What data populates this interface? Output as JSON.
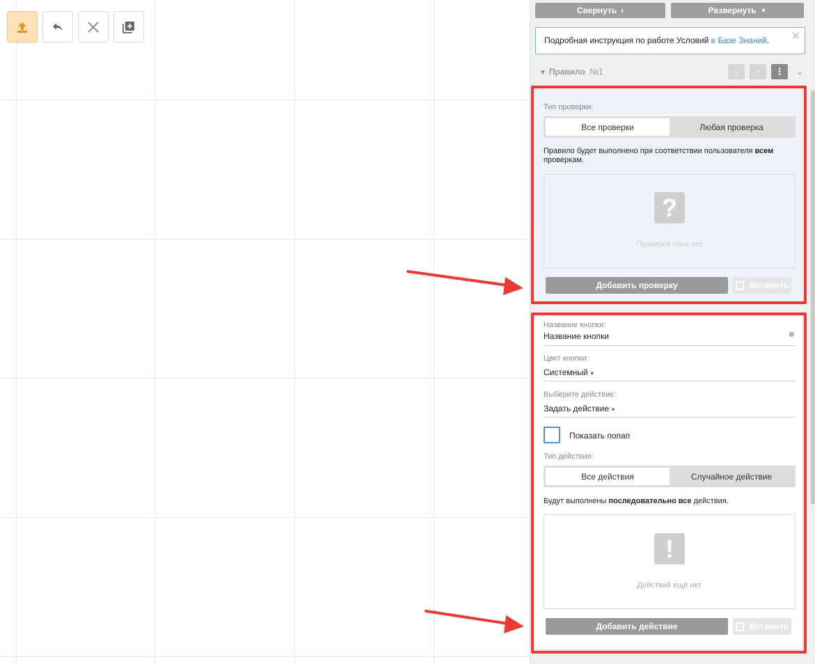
{
  "toolbar": {
    "buttons": [
      {
        "name": "upload-icon",
        "active": true
      },
      {
        "name": "undo-icon",
        "active": false
      },
      {
        "name": "close-icon",
        "active": false
      },
      {
        "name": "add-copy-icon",
        "active": false
      }
    ]
  },
  "panel": {
    "collapse_label": "Свернуть",
    "expand_label": "Развернуть",
    "info_text": "Подробная инструкция по работе Условий ",
    "info_link": "в Базе Знаний",
    "info_dot": ".",
    "info_close": "✕",
    "rule_title": "Правило",
    "rule_number": "№1"
  },
  "checks": {
    "type_label": "Тип проверки:",
    "option_all": "Все проверки",
    "option_any": "Любая проверка",
    "desc_pre": "Правило будет выполнено при соответствии пользователя ",
    "desc_bold": "всем",
    "desc_post": " проверкам.",
    "empty_icon": "?",
    "empty_text": "Проверок пока нет",
    "add_button": "Добавить проверку",
    "paste_button": "Вставить"
  },
  "button_settings": {
    "name_label": "Название кнопки:",
    "name_value": "Название кнопки",
    "color_label": "Цвет кнопки:",
    "color_value": "Системный",
    "action_label": "Выберите действие:",
    "action_value": "Задать действие",
    "popup_label": "Показать попап",
    "action_type_label": "Тип действия:",
    "option_all_actions": "Все действия",
    "option_random_action": "Случайное действие",
    "desc_pre": "Будут выполнены ",
    "desc_bold": "последовательно все",
    "desc_post": " действия.",
    "empty_icon": "!",
    "empty_text": "Действий ещё нет",
    "add_button": "Добавить действие",
    "paste_button": "Вставить"
  },
  "colors": {
    "highlight": "#ea3a35",
    "accent_link": "#3a86c8",
    "button_gray": "#9a9a9a"
  }
}
